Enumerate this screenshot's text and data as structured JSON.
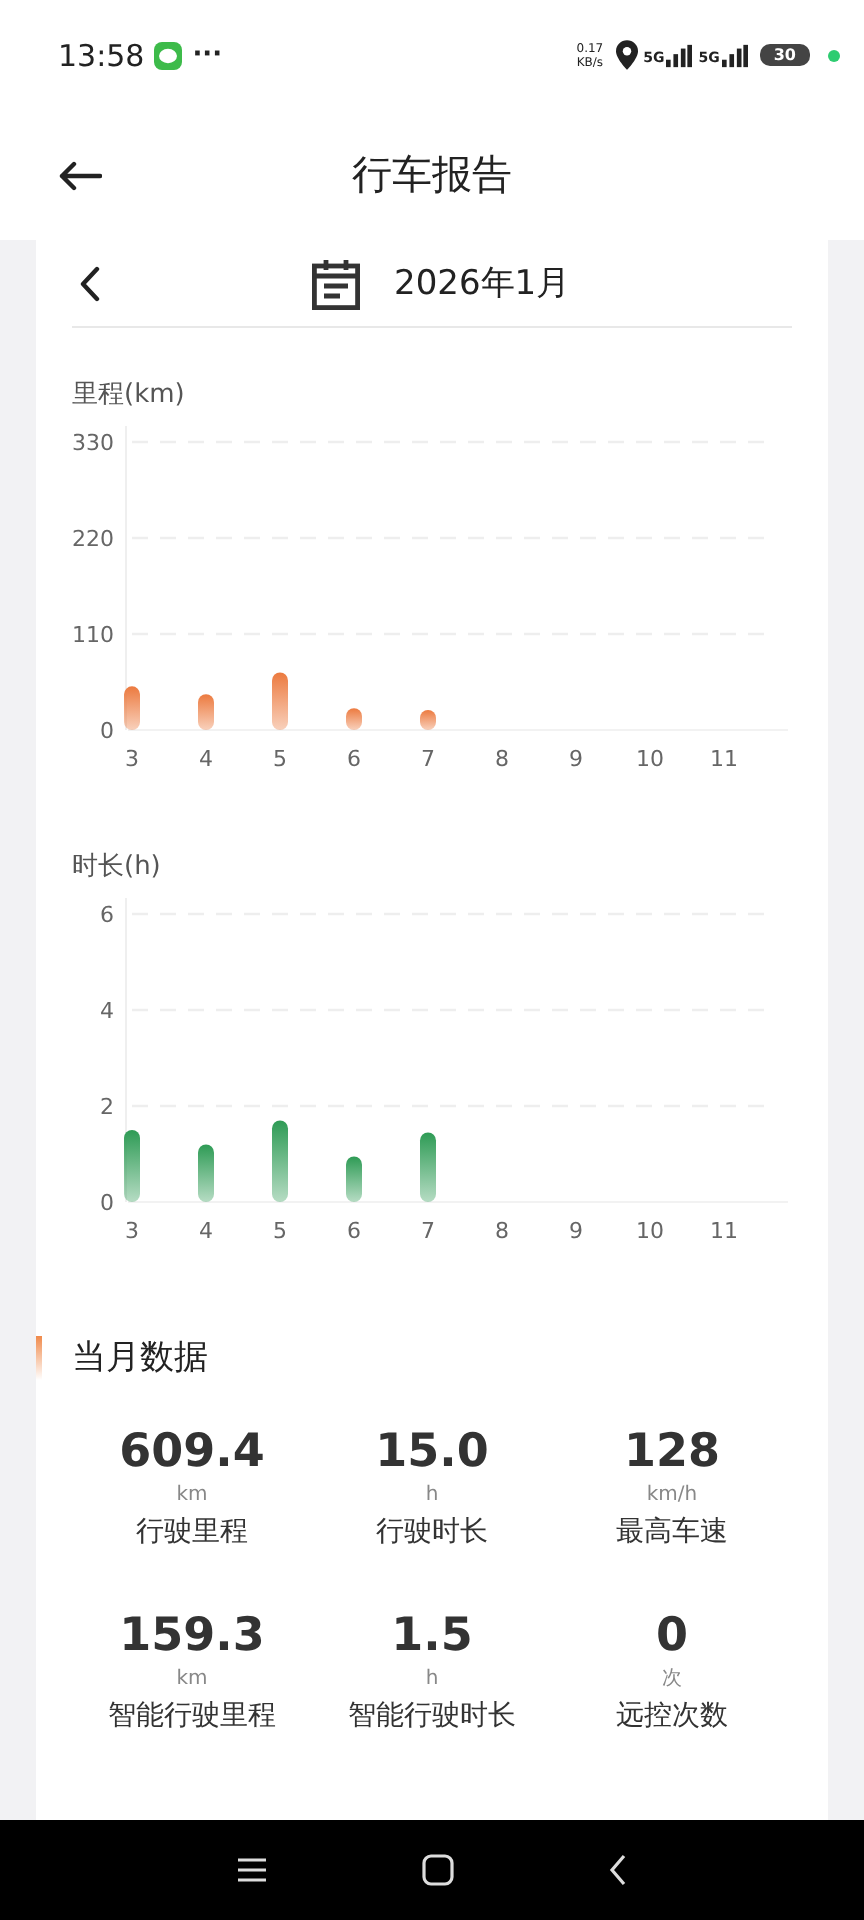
{
  "status_bar": {
    "time": "13:58",
    "more": "···",
    "speed_value": "0.17",
    "speed_unit": "KB/s",
    "network_1": "5G",
    "network_2": "5G",
    "battery": "30"
  },
  "header": {
    "title": "行车报告"
  },
  "month_picker": {
    "label": "2026年1月"
  },
  "charts": [
    {
      "chart_data": {
        "type": "bar",
        "title": "里程(km)",
        "categories": [
          "3",
          "4",
          "5",
          "6",
          "7",
          "8",
          "9",
          "10",
          "11"
        ],
        "series": [
          {
            "color": "#ec7a3f",
            "values": [
              50,
              41,
              66,
              25,
              23,
              null,
              null,
              null,
              null
            ]
          }
        ],
        "ylim": [
          0,
          330
        ],
        "yticks": [
          0,
          110,
          220,
          330
        ]
      }
    },
    {
      "chart_data": {
        "type": "bar",
        "title": "时长(h)",
        "categories": [
          "3",
          "4",
          "5",
          "6",
          "7",
          "8",
          "9",
          "10",
          "11"
        ],
        "series": [
          {
            "color": "#2e9b55",
            "values": [
              1.5,
              1.2,
              1.7,
              0.95,
              1.45,
              null,
              null,
              null,
              null
            ]
          }
        ],
        "ylim": [
          0,
          6
        ],
        "yticks": [
          0,
          2,
          4,
          6
        ]
      }
    }
  ],
  "monthly": {
    "title": "当月数据",
    "stats": [
      {
        "value": "609.4",
        "unit": "km",
        "label": "行驶里程"
      },
      {
        "value": "15.0",
        "unit": "h",
        "label": "行驶时长"
      },
      {
        "value": "128",
        "unit": "km/h",
        "label": "最高车速"
      },
      {
        "value": "159.3",
        "unit": "km",
        "label": "智能行驶里程"
      },
      {
        "value": "1.5",
        "unit": "h",
        "label": "智能行驶时长"
      },
      {
        "value": "0",
        "unit": "次",
        "label": "远控次数"
      }
    ]
  }
}
